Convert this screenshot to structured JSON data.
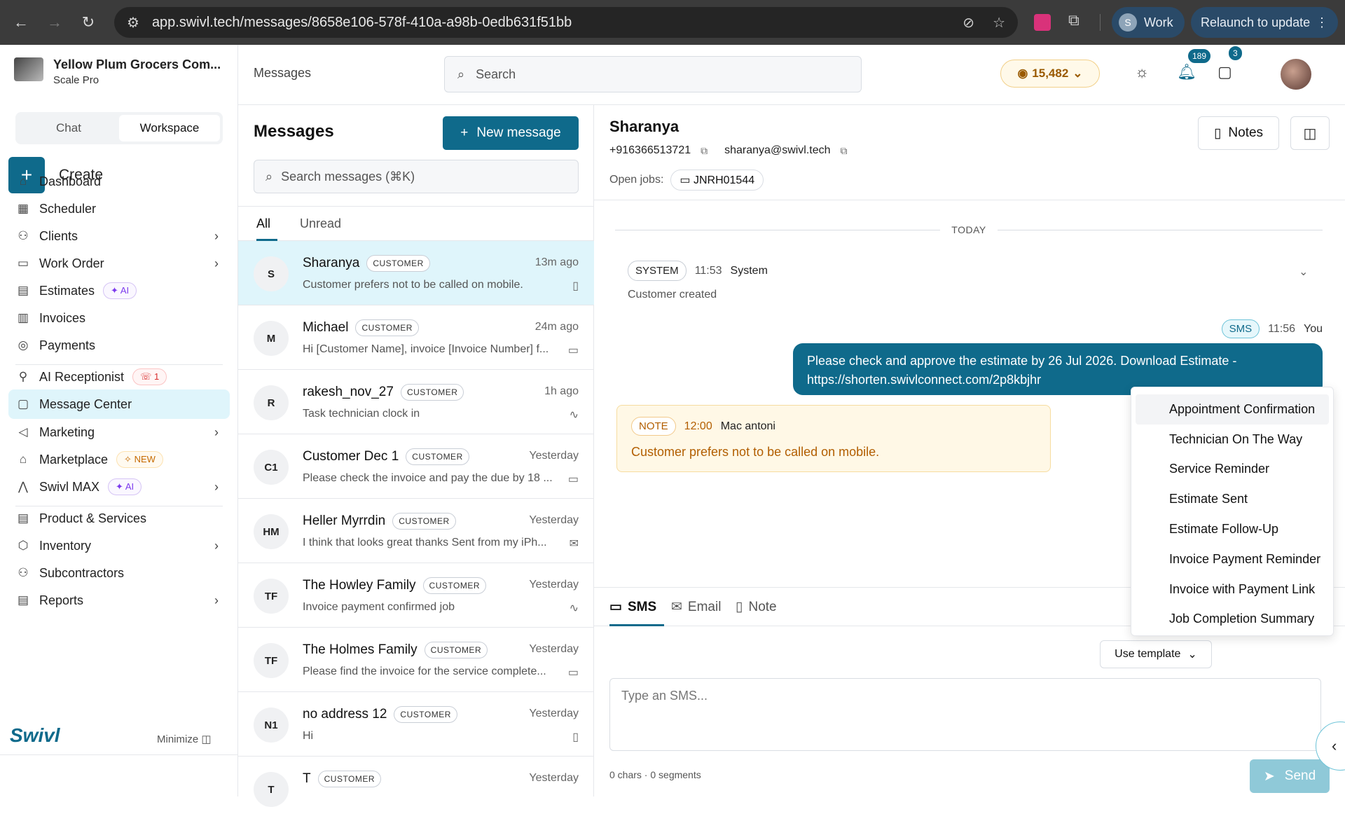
{
  "browser": {
    "url": "app.swivl.tech/messages/8658e106-578f-410a-a98b-0edb631f51bb",
    "profile_initial": "S",
    "profile_label": "Work",
    "relaunch_label": "Relaunch to update"
  },
  "sidebar": {
    "company": "Yellow Plum Grocers Com...",
    "plan": "Scale Pro",
    "toggle": [
      "Chat",
      "Workspace"
    ],
    "toggle_active": "Workspace",
    "create_label": "Create",
    "items": [
      {
        "label": "Dashboard",
        "icon": "home-icon"
      },
      {
        "label": "Scheduler",
        "icon": "calendar-icon"
      },
      {
        "label": "Clients",
        "icon": "user-plus-icon"
      },
      {
        "label": "Work Order",
        "icon": "briefcase-icon"
      },
      {
        "label": "Estimates",
        "icon": "document-icon",
        "badge": "AI"
      },
      {
        "label": "Invoices",
        "icon": "invoice-icon"
      },
      {
        "label": "Payments",
        "icon": "coins-icon"
      },
      {
        "label": "AI Receptionist",
        "icon": "agent-icon",
        "badge": "1"
      },
      {
        "label": "Message Center",
        "icon": "message-icon"
      },
      {
        "label": "Marketing",
        "icon": "megaphone-icon"
      },
      {
        "label": "Marketplace",
        "icon": "store-icon",
        "badge": "NEW"
      },
      {
        "label": "Swivl MAX",
        "icon": "max-icon",
        "badge": "AI"
      },
      {
        "label": "Product & Services",
        "icon": "list-icon"
      },
      {
        "label": "Inventory",
        "icon": "box-icon"
      },
      {
        "label": "Subcontractors",
        "icon": "users-icon"
      },
      {
        "label": "Reports",
        "icon": "report-icon"
      }
    ],
    "logo": "Swivl",
    "minimize_label": "Minimize"
  },
  "topbar": {
    "breadcrumb": "Messages",
    "search_placeholder": "Search",
    "coins": "15,482",
    "notifications": "189",
    "messages_count": "3"
  },
  "list": {
    "title": "Messages",
    "new_label": "New message",
    "search_placeholder": "Search messages (⌘K)",
    "tabs": [
      "All",
      "Unread"
    ],
    "conversations": [
      {
        "initials": "S",
        "name": "Sharanya",
        "tag": "CUSTOMER",
        "time": "13m ago",
        "preview": "Customer prefers not to be called on mobile.",
        "icon": "note-icon"
      },
      {
        "initials": "M",
        "name": "Michael",
        "tag": "CUSTOMER",
        "time": "24m ago",
        "preview": "Hi [Customer Name], invoice [Invoice Number] f...",
        "icon": "sms-icon"
      },
      {
        "initials": "R",
        "name": "rakesh_nov_27",
        "tag": "CUSTOMER",
        "time": "1h ago",
        "preview": "Task technician clock in",
        "icon": "activity-icon"
      },
      {
        "initials": "C1",
        "name": "Customer Dec 1",
        "tag": "CUSTOMER",
        "time": "Yesterday",
        "preview": "Please check the invoice and pay the due by 18 ...",
        "icon": "sms-icon"
      },
      {
        "initials": "HM",
        "name": "Heller Myrrdin",
        "tag": "CUSTOMER",
        "time": "Yesterday",
        "preview": "I think that looks great thanks Sent from my iPh...",
        "icon": "mail-icon"
      },
      {
        "initials": "TF",
        "name": "The Howley Family",
        "tag": "CUSTOMER",
        "time": "Yesterday",
        "preview": "Invoice payment confirmed job",
        "icon": "activity-icon"
      },
      {
        "initials": "TF",
        "name": "The Holmes Family",
        "tag": "CUSTOMER",
        "time": "Yesterday",
        "preview": "Please find the invoice for the service complete...",
        "icon": "sms-icon"
      },
      {
        "initials": "N1",
        "name": "no address 12",
        "tag": "CUSTOMER",
        "time": "Yesterday",
        "preview": "Hi",
        "icon": "note-icon"
      },
      {
        "initials": "T",
        "name": "T",
        "tag": "CUSTOMER",
        "time": "Yesterday",
        "preview": "",
        "icon": ""
      }
    ]
  },
  "chat": {
    "name": "Sharanya",
    "phone": "+916366513721",
    "email": "sharanya@swivl.tech",
    "open_jobs_label": "Open jobs:",
    "job_id": "JNRH01544",
    "notes_label": "Notes",
    "day_label": "TODAY",
    "system": {
      "chip": "SYSTEM",
      "time": "11:53",
      "author": "System",
      "text": "Customer created"
    },
    "sms": {
      "chip": "SMS",
      "time": "11:56",
      "author": "You",
      "line1": "Please check and approve the estimate by 26 Jul 2026. Download Estimate -",
      "line2": "https://shorten.swivlconnect.com/2p8kbjhr"
    },
    "note": {
      "chip": "NOTE",
      "time": "12:00",
      "author": "Mac antoni",
      "text": "Customer prefers not to be called on mobile."
    },
    "tabs": [
      "SMS",
      "Email",
      "Note"
    ],
    "use_template_label": "Use template",
    "compose_placeholder": "Type an SMS...",
    "counter": "0 chars · 0 segments",
    "send_label": "Send"
  },
  "template_menu": [
    "Appointment Confirmation",
    "Technician On The Way",
    "Service Reminder",
    "Estimate Sent",
    "Estimate Follow-Up",
    "Invoice Payment Reminder",
    "Invoice with Payment Link",
    "Job Completion Summary"
  ],
  "colors": {
    "brand": "#0f6a8b",
    "selected": "#dff5fb",
    "note_bg": "#fff8e6",
    "note_text": "#b25e00"
  }
}
